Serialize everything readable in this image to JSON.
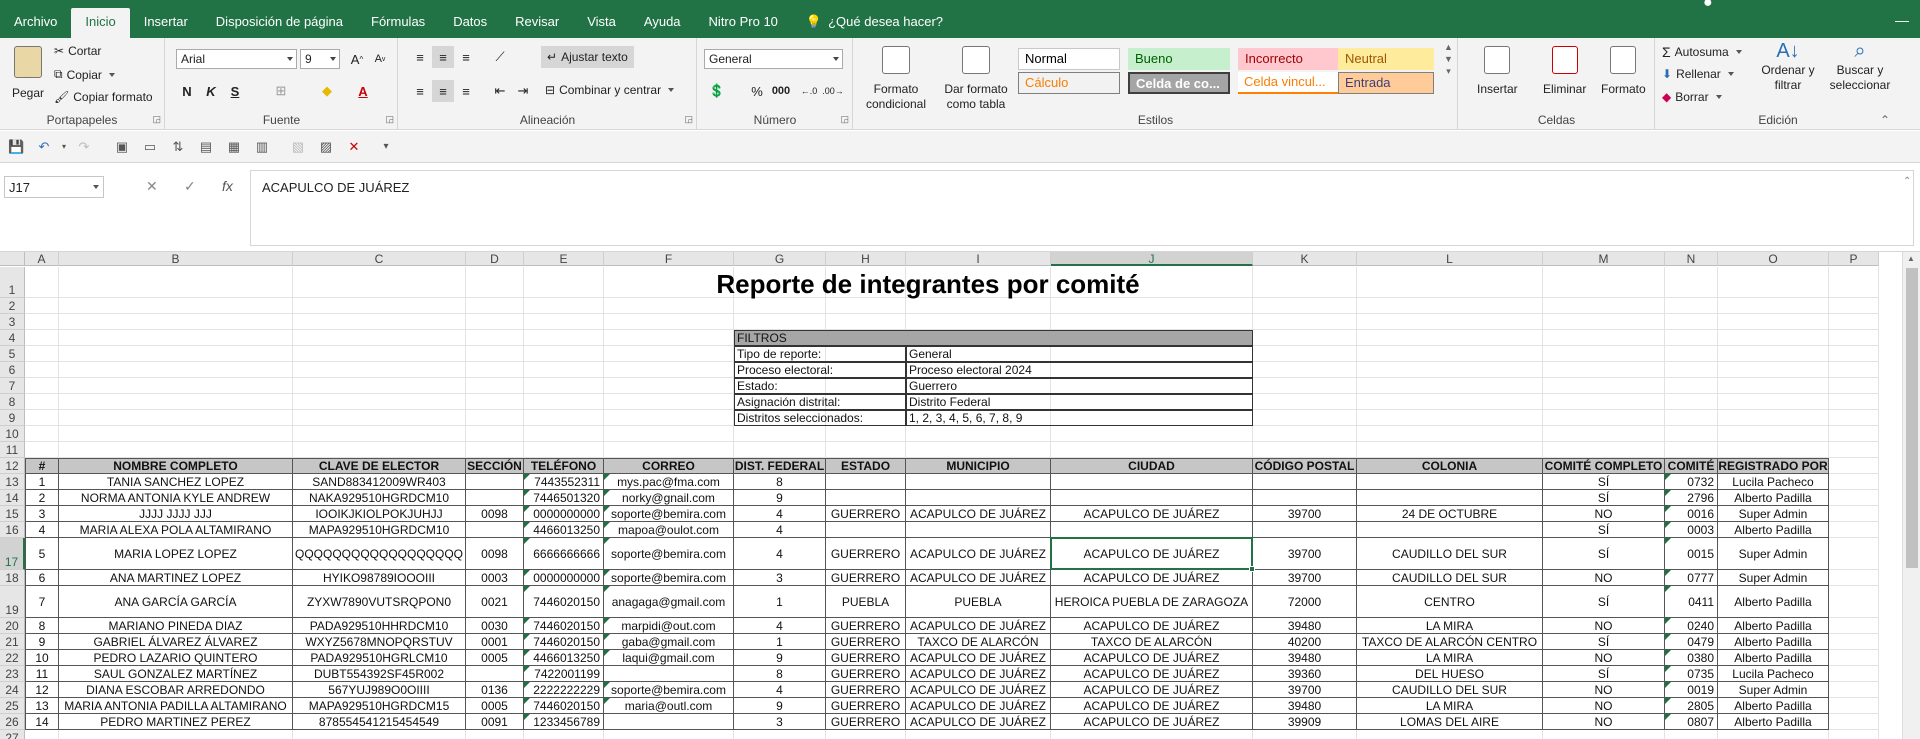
{
  "menu": {
    "tabs": [
      "Archivo",
      "Inicio",
      "Insertar",
      "Disposición de página",
      "Fórmulas",
      "Datos",
      "Revisar",
      "Vista",
      "Ayuda",
      "Nitro Pro 10",
      "¿Qué desea hacer?"
    ]
  },
  "ribbon": {
    "portapapeles": {
      "pegar": "Pegar",
      "cortar": "Cortar",
      "copiar": "Copiar",
      "copiar_formato": "Copiar formato",
      "label": "Portapapeles"
    },
    "fuente": {
      "font": "Arial",
      "size": "9",
      "bold": "N",
      "italic": "K",
      "underline": "S",
      "font_color": "A",
      "label": "Fuente"
    },
    "alineacion": {
      "ajustar": "Ajustar texto",
      "combinar": "Combinar y centrar",
      "label": "Alineación"
    },
    "numero": {
      "format": "General",
      "percent": "%",
      "label": "Número"
    },
    "estilos": {
      "formato_condicional": "Formato condicional",
      "dar_formato": "Dar formato como tabla",
      "styles": [
        {
          "name": "Normal",
          "bg": "#ffffff",
          "fg": "#000000",
          "border": "#c8c8c8"
        },
        {
          "name": "Bueno",
          "bg": "#c6efce",
          "fg": "#006100",
          "border": "#c6efce"
        },
        {
          "name": "Incorrecto",
          "bg": "#ffc7ce",
          "fg": "#9c0006",
          "border": "#ffc7ce"
        },
        {
          "name": "Neutral",
          "bg": "#ffeb9c",
          "fg": "#9c5700",
          "border": "#ffeb9c"
        },
        {
          "name": "Cálculo",
          "bg": "#f2f2f2",
          "fg": "#fa7d00",
          "border": "#7f7f7f"
        },
        {
          "name": "Celda de co...",
          "bg": "#a5a5a5",
          "fg": "#ffffff",
          "border": "#3f3f3f"
        },
        {
          "name": "Celda vincul...",
          "bg": "#ffffff",
          "fg": "#fa7d00",
          "border": "#ff8001"
        },
        {
          "name": "Entrada",
          "bg": "#ffcc99",
          "fg": "#3f3f76",
          "border": "#7f7f7f"
        }
      ],
      "label": "Estilos"
    },
    "celdas": {
      "insertar": "Insertar",
      "eliminar": "Eliminar",
      "formato": "Formato",
      "label": "Celdas"
    },
    "edicion": {
      "autosuma": "Autosuma",
      "rellenar": "Rellenar",
      "borrar": "Borrar",
      "ordenar": "Ordenar y filtrar",
      "buscar": "Buscar y seleccionar",
      "label": "Edición"
    }
  },
  "formula_bar": {
    "name_box": "J17",
    "fx": "fx",
    "content": "ACAPULCO DE JUÁREZ"
  },
  "sheet": {
    "columns": [
      "A",
      "B",
      "C",
      "D",
      "E",
      "F",
      "G",
      "H",
      "I",
      "J",
      "K",
      "L",
      "M",
      "N",
      "O",
      "P"
    ],
    "title": "Reporte de integrantes por comité",
    "filters": {
      "header": "FILTROS",
      "rows": [
        [
          "Tipo de reporte:",
          "General"
        ],
        [
          "Proceso electoral:",
          "Proceso electoral 2024"
        ],
        [
          "Estado:",
          "Guerrero"
        ],
        [
          "Asignación distrital:",
          "Distrito Federal"
        ],
        [
          "Distritos seleccionados:",
          "1, 2, 3, 4, 5, 6, 7, 8, 9"
        ]
      ]
    },
    "headers": [
      "#",
      "NOMBRE COMPLETO",
      "CLAVE DE ELECTOR",
      "SECCIÓN",
      "TELÉFONO",
      "CORREO",
      "DIST. FEDERAL",
      "ESTADO",
      "MUNICIPIO",
      "CIUDAD",
      "CÓDIGO POSTAL",
      "COLONIA",
      "COMITÉ COMPLETO",
      "COMITÉ",
      "REGISTRADO POR"
    ],
    "rows": [
      [
        "1",
        "TANIA SANCHEZ LOPEZ",
        "SAND883412009WR403",
        "",
        "7443552311",
        "mys.pac@fma.com",
        "8",
        "",
        "",
        "",
        "",
        "",
        "SÍ",
        "0732",
        "Lucila Pacheco"
      ],
      [
        "2",
        "NORMA ANTONIA KYLE ANDREW",
        "NAKA929510HGRDCM10",
        "",
        "7446501320",
        "norky@gnail.com",
        "9",
        "",
        "",
        "",
        "",
        "",
        "SÍ",
        "2796",
        "Alberto Padilla"
      ],
      [
        "3",
        "JJJJ JJJJ JJJ",
        "IOOIKJKIOLPOKJUHJJ",
        "0098",
        "0000000000",
        "soporte@bemira.com",
        "4",
        "GUERRERO",
        "ACAPULCO DE JUÁREZ",
        "ACAPULCO DE JUÁREZ",
        "39700",
        "24 DE OCTUBRE",
        "NO",
        "0016",
        "Super Admin"
      ],
      [
        "4",
        "MARIA ALEXA POLA ALTAMIRANO",
        "MAPA929510HGRDCM10",
        "",
        "4466013250",
        "mapoa@oulot.com",
        "4",
        "",
        "",
        "",
        "",
        "",
        "SÍ",
        "0003",
        "Alberto Padilla"
      ],
      [
        "5",
        "MARIA LOPEZ LOPEZ",
        "QQQQQQQQQQQQQQQQQQ",
        "0098",
        "6666666666",
        "soporte@bemira.com",
        "4",
        "GUERRERO",
        "ACAPULCO DE JUÁREZ",
        "ACAPULCO DE JUÁREZ",
        "39700",
        "CAUDILLO DEL SUR",
        "SÍ",
        "0015",
        "Super Admin"
      ],
      [
        "6",
        "ANA MARTINEZ LOPEZ",
        "HYIKO98789IOOOIII",
        "0003",
        "0000000000",
        "soporte@bemira.com",
        "3",
        "GUERRERO",
        "ACAPULCO DE JUÁREZ",
        "ACAPULCO DE JUÁREZ",
        "39700",
        "CAUDILLO DEL SUR",
        "NO",
        "0777",
        "Super Admin"
      ],
      [
        "7",
        "ANA GARCÍA GARCÍA",
        "ZYXW7890VUTSRQPON0",
        "0021",
        "7446020150",
        "anagaga@gmail.com",
        "1",
        "PUEBLA",
        "PUEBLA",
        "HEROICA PUEBLA DE ZARAGOZA",
        "72000",
        "CENTRO",
        "SÍ",
        "0411",
        "Alberto Padilla"
      ],
      [
        "8",
        "MARIANO PINEDA DIAZ",
        "PADA929510HHRDCM10",
        "0030",
        "7446020150",
        "marpidi@out.com",
        "4",
        "GUERRERO",
        "ACAPULCO DE JUÁREZ",
        "ACAPULCO DE JUÁREZ",
        "39480",
        "LA MIRA",
        "NO",
        "0240",
        "Alberto Padilla"
      ],
      [
        "9",
        "GABRIEL ÁLVAREZ ÁLVAREZ",
        "WXYZ5678MNOPQRSTUV",
        "0001",
        "7446020150",
        "gaba@gmail.com",
        "1",
        "GUERRERO",
        "TAXCO DE ALARCÓN",
        "TAXCO DE ALARCÓN",
        "40200",
        "TAXCO DE ALARCÓN CENTRO",
        "SÍ",
        "0479",
        "Alberto Padilla"
      ],
      [
        "10",
        "PEDRO LAZARIO QUINTERO",
        "PADA929510HGRLCM10",
        "0005",
        "4466013250",
        "laqui@gmail.com",
        "9",
        "GUERRERO",
        "ACAPULCO DE JUÁREZ",
        "ACAPULCO DE JUÁREZ",
        "39480",
        "LA MIRA",
        "NO",
        "0380",
        "Alberto Padilla"
      ],
      [
        "11",
        "SAUL GONZALEZ MARTÍNEZ",
        "DUBT554392SF45R002",
        "",
        "7422001199",
        "",
        "8",
        "GUERRERO",
        "ACAPULCO DE JUÁREZ",
        "ACAPULCO DE JUÁREZ",
        "39360",
        "DEL HUESO",
        "SÍ",
        "0735",
        "Lucila Pacheco"
      ],
      [
        "12",
        "DIANA ESCOBAR ARREDONDO",
        "567YUJ989O0OIIII",
        "0136",
        "2222222229",
        "soporte@bemira.com",
        "4",
        "GUERRERO",
        "ACAPULCO DE JUÁREZ",
        "ACAPULCO DE JUÁREZ",
        "39700",
        "CAUDILLO DEL SUR",
        "NO",
        "0019",
        "Super Admin"
      ],
      [
        "13",
        "MARIA ANTONIA PADILLA ALTAMIRANO",
        "MAPA929510HGRDCM15",
        "0005",
        "7446020150",
        "maria@outl.com",
        "9",
        "GUERRERO",
        "ACAPULCO DE JUÁREZ",
        "ACAPULCO DE JUÁREZ",
        "39480",
        "LA MIRA",
        "NO",
        "2805",
        "Alberto Padilla"
      ],
      [
        "14",
        "PEDRO MARTINEZ PEREZ",
        "878554541215454549",
        "0091",
        "1233456789",
        "",
        "3",
        "GUERRERO",
        "ACAPULCO DE JUÁREZ",
        "ACAPULCO DE JUÁREZ",
        "39909",
        "LOMAS DEL AIRE",
        "NO",
        "0807",
        "Alberto Padilla"
      ]
    ]
  }
}
